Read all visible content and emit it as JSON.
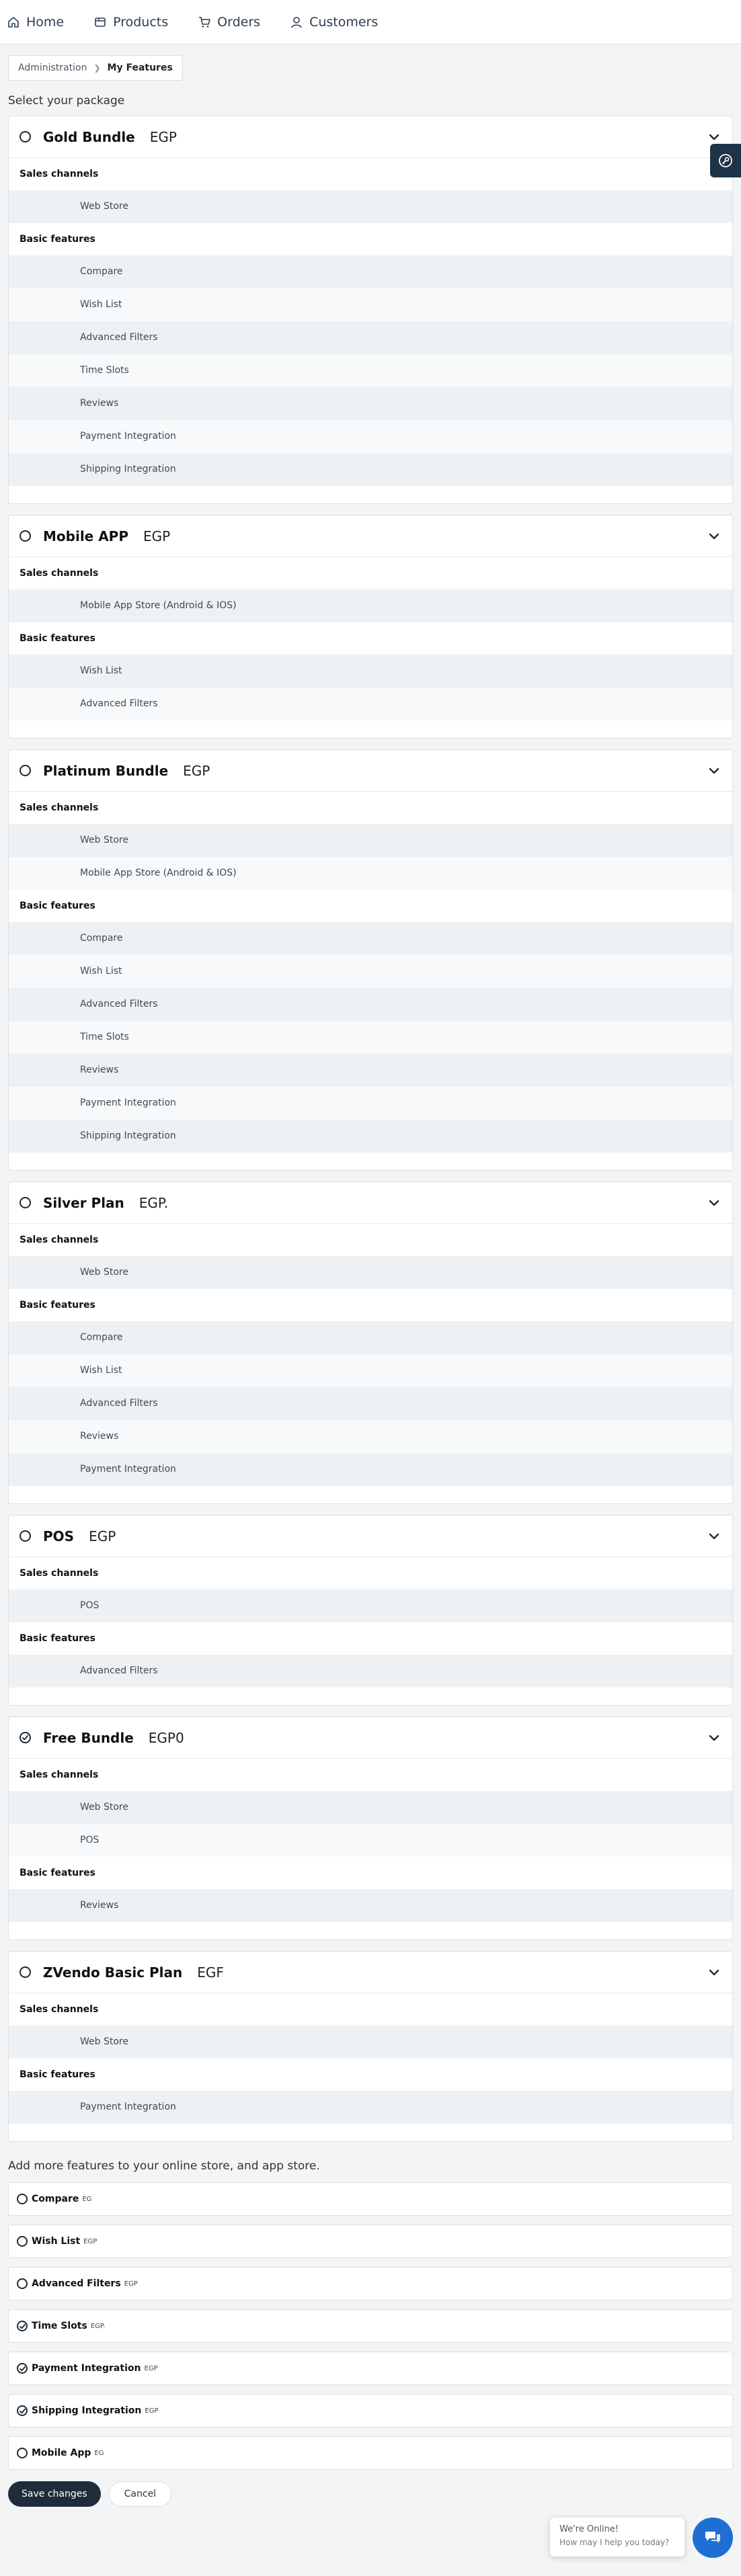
{
  "nav": [
    {
      "label": "Home",
      "icon": "home-icon"
    },
    {
      "label": "Products",
      "icon": "products-icon"
    },
    {
      "label": "Orders",
      "icon": "cart-icon"
    },
    {
      "label": "Customers",
      "icon": "user-icon"
    }
  ],
  "breadcrumb": {
    "parent": "Administration",
    "current": "My Features"
  },
  "select_package_label": "Select your package",
  "group_labels": {
    "sales": "Sales channels",
    "basic": "Basic features"
  },
  "packages": [
    {
      "name": "Gold Bundle",
      "price": "EGP",
      "selected": false,
      "sales": [
        "Web Store"
      ],
      "basic": [
        "Compare",
        "Wish List",
        "Advanced Filters",
        "Time Slots",
        "Reviews",
        "Payment Integration",
        "Shipping Integration"
      ]
    },
    {
      "name": "Mobile APP",
      "price": "EGP",
      "selected": false,
      "sales": [
        "Mobile App Store (Android & IOS)"
      ],
      "basic": [
        "Wish List",
        "Advanced Filters"
      ]
    },
    {
      "name": "Platinum Bundle",
      "price": "EGP",
      "selected": false,
      "sales": [
        "Web Store",
        "Mobile App Store (Android & IOS)"
      ],
      "basic": [
        "Compare",
        "Wish List",
        "Advanced Filters",
        "Time Slots",
        "Reviews",
        "Payment Integration",
        "Shipping Integration"
      ]
    },
    {
      "name": "Silver Plan",
      "price": "EGP.",
      "selected": false,
      "sales": [
        "Web Store"
      ],
      "basic": [
        "Compare",
        "Wish List",
        "Advanced Filters",
        "Reviews",
        "Payment Integration"
      ]
    },
    {
      "name": "POS",
      "price": "EGP",
      "selected": false,
      "sales": [
        "POS"
      ],
      "basic": [
        "Advanced Filters"
      ]
    },
    {
      "name": "Free Bundle",
      "price": "EGP0",
      "selected": true,
      "sales": [
        "Web Store",
        "POS"
      ],
      "basic": [
        "Reviews"
      ]
    },
    {
      "name": "ZVendo Basic Plan",
      "price": "EGF",
      "selected": false,
      "sales": [
        "Web Store"
      ],
      "basic": [
        "Payment Integration"
      ]
    }
  ],
  "addons_title": "Add more features to your online store, and app store.",
  "addons": [
    {
      "name": "Compare",
      "price": "EG",
      "selected": false
    },
    {
      "name": "Wish List",
      "price": "EGP",
      "selected": false
    },
    {
      "name": "Advanced Filters",
      "price": "EGP",
      "selected": false
    },
    {
      "name": "Time Slots",
      "price": "EGP.",
      "selected": true
    },
    {
      "name": "Payment Integration",
      "price": "EGP",
      "selected": true
    },
    {
      "name": "Shipping Integration",
      "price": "EGP",
      "selected": true
    },
    {
      "name": "Mobile App",
      "price": "EG",
      "selected": false
    }
  ],
  "actions": {
    "save": "Save changes",
    "cancel": "Cancel"
  },
  "chat": {
    "title": "We're Online!",
    "subtitle": "How may I help you today?"
  },
  "colors": {
    "primary": "#1f2d3a",
    "chat": "#1f6ed4",
    "row_alt": "#edf1f4"
  }
}
